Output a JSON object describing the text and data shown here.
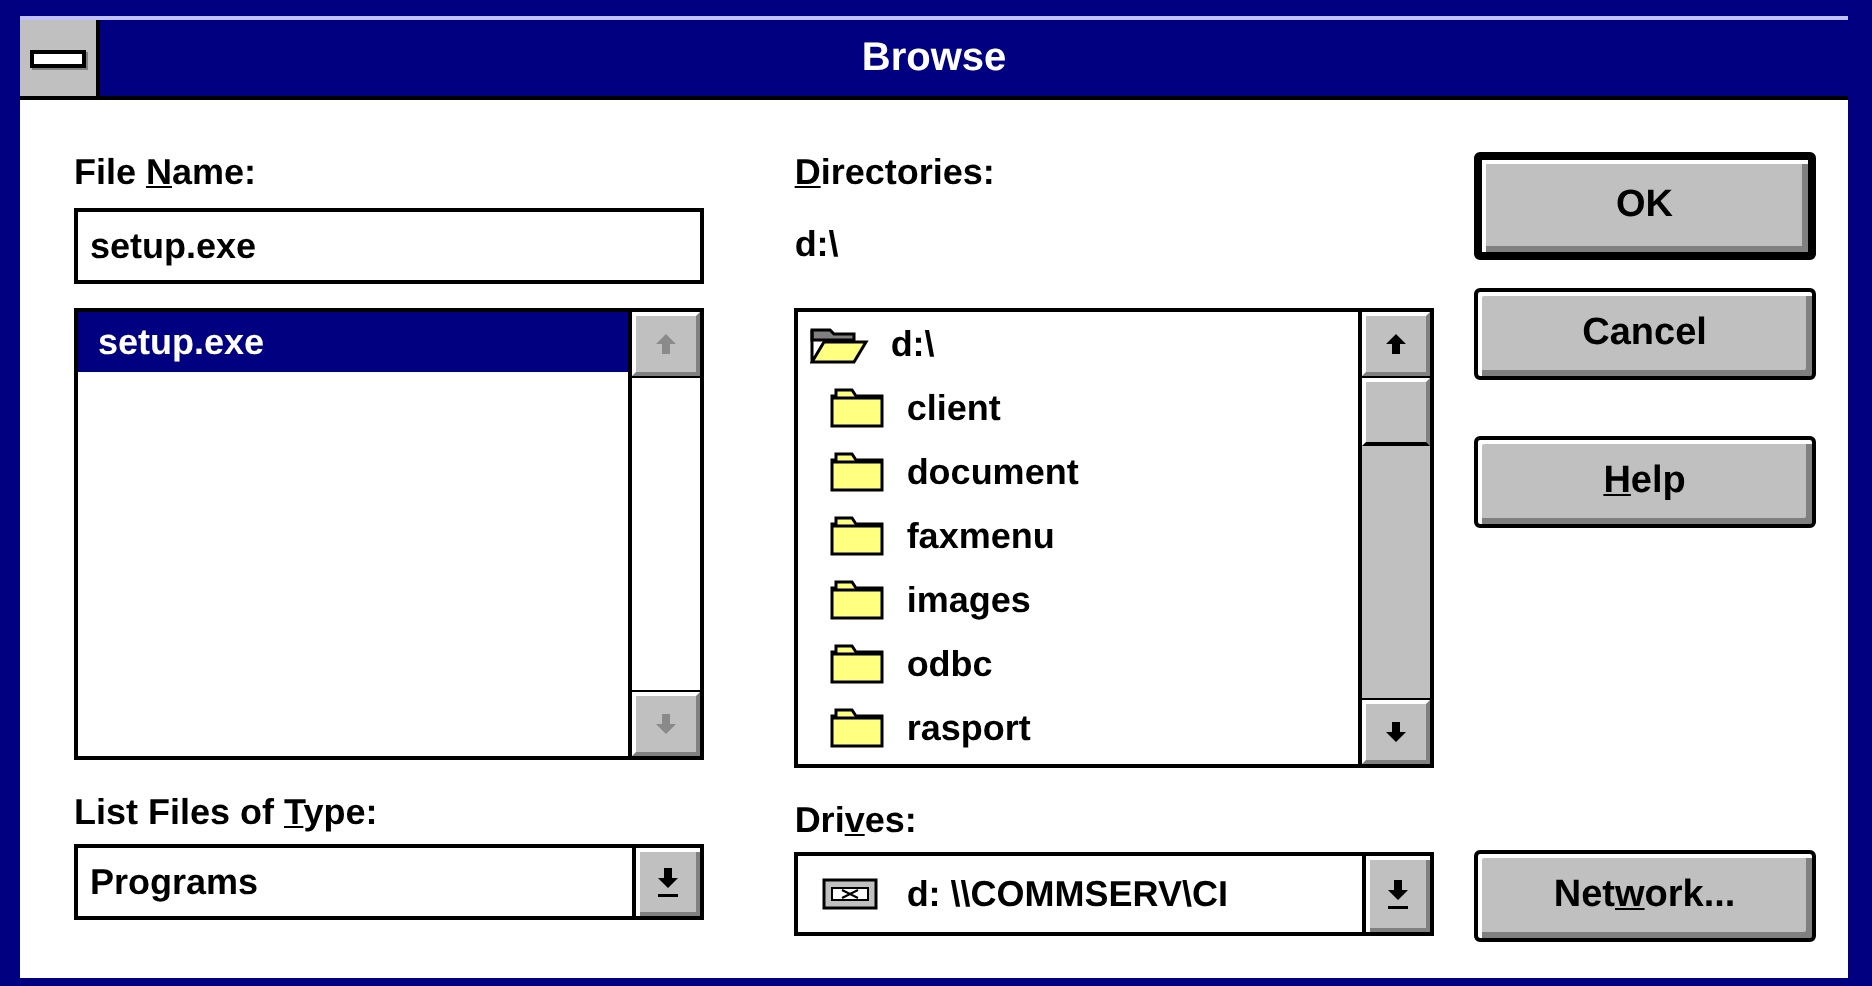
{
  "window": {
    "title": "Browse"
  },
  "file_name": {
    "label": {
      "before": "File ",
      "key": "N",
      "after": "ame:"
    },
    "value": "setup.exe"
  },
  "files": {
    "scroll_disabled": true,
    "items": [
      {
        "name": "setup.exe",
        "selected": true
      }
    ]
  },
  "file_type": {
    "label": {
      "before": "List Files of ",
      "key": "T",
      "after": "ype:"
    },
    "value": "Programs"
  },
  "directories": {
    "label": {
      "key": "D",
      "after": "irectories:"
    },
    "path": "d:\\",
    "items": [
      {
        "name": "d:\\",
        "kind": "open"
      },
      {
        "name": "client",
        "kind": "closed"
      },
      {
        "name": "document",
        "kind": "closed"
      },
      {
        "name": "faxmenu",
        "kind": "closed"
      },
      {
        "name": "images",
        "kind": "closed"
      },
      {
        "name": "odbc",
        "kind": "closed"
      },
      {
        "name": "rasport",
        "kind": "closed"
      }
    ]
  },
  "drives": {
    "label": {
      "before": "Dri",
      "key": "v",
      "after": "es:"
    },
    "value": "d: \\\\COMMSERV\\CI"
  },
  "buttons": [
    {
      "after": "OK",
      "default": true
    },
    {
      "after": "Cancel",
      "default": false
    },
    {
      "key": "H",
      "after": "elp",
      "default": false
    }
  ],
  "network_button": {
    "before": "Net",
    "key": "w",
    "after": "ork...",
    "default": false
  }
}
